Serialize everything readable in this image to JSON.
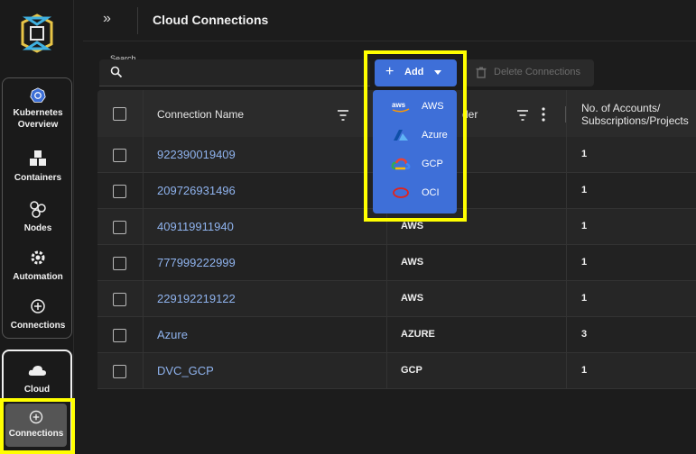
{
  "sidebar": {
    "items": [
      {
        "label_1": "Kubernetes",
        "label_2": "Overview",
        "icon": "kubernetes-icon"
      },
      {
        "label": "Containers",
        "icon": "cubes-icon"
      },
      {
        "label": "Nodes",
        "icon": "nodes-icon"
      },
      {
        "label": "Automation",
        "icon": "gear-icon"
      },
      {
        "label": "Connections",
        "icon": "plus-circle-icon"
      }
    ],
    "cloud": {
      "label": "Cloud",
      "icon": "cloud-icon"
    },
    "active": {
      "label": "Connections",
      "icon": "plus-circle-icon"
    }
  },
  "header": {
    "title": "Cloud Connections",
    "expand_icon": "chevrons-right-icon"
  },
  "toolbar": {
    "search_label": "Search",
    "search_placeholder": "",
    "add_label": "Add",
    "delete_label": "Delete Connections"
  },
  "add_menu": {
    "items": [
      {
        "label": "AWS",
        "icon": "aws-logo-icon"
      },
      {
        "label": "Azure",
        "icon": "azure-logo-icon"
      },
      {
        "label": "GCP",
        "icon": "gcp-logo-icon"
      },
      {
        "label": "OCI",
        "icon": "oci-logo-icon"
      }
    ]
  },
  "table": {
    "columns": {
      "name": "Connection Name",
      "provider_partial": "der",
      "accounts_1": "No. of Accounts/",
      "accounts_2": "Subscriptions/Projects"
    },
    "rows": [
      {
        "name": "922390019409",
        "provider": "",
        "accounts": "1"
      },
      {
        "name": "209726931496",
        "provider": "",
        "accounts": "1"
      },
      {
        "name": "409119911940",
        "provider": "AWS",
        "accounts": "1"
      },
      {
        "name": "777999222999",
        "provider": "AWS",
        "accounts": "1"
      },
      {
        "name": "229192219122",
        "provider": "AWS",
        "accounts": "1"
      },
      {
        "name": "Azure",
        "provider": "AZURE",
        "accounts": "3"
      },
      {
        "name": "DVC_GCP",
        "provider": "GCP",
        "accounts": "1"
      }
    ]
  },
  "colors": {
    "accent": "#3e6fd8",
    "highlight": "#ffff00",
    "link": "#8fb3ee"
  }
}
